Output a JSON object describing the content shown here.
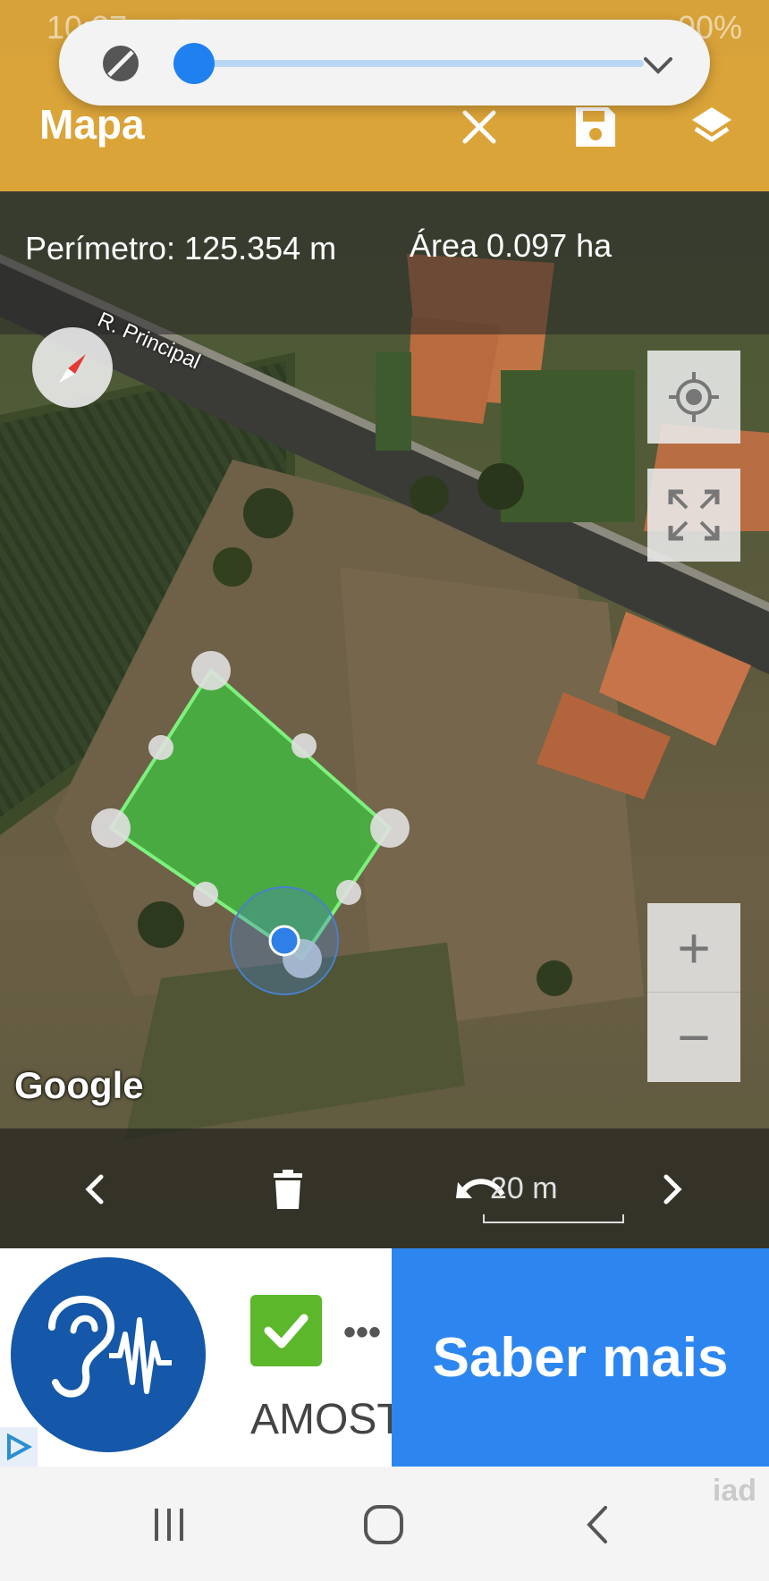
{
  "status_bar": {
    "time": "10:27",
    "battery": "90%"
  },
  "app_bar": {
    "title": "Mapa"
  },
  "map": {
    "perimeter_label": "Perímetro: 125.354 m",
    "area_label": "Área 0.097 ha",
    "street_label": "R. Principal",
    "attribution": "Google",
    "scale_label": "20 m",
    "polygon_fill": "#3fbf3f",
    "polygon_stroke": "#7ef07e"
  },
  "ad": {
    "title_text": "AMOSTRA",
    "cta_label": "Saber mais",
    "cta_color": "#2d86f0"
  },
  "watermark": "iad",
  "colors": {
    "app_bar": "#dba439",
    "accent": "#1f80f0"
  }
}
